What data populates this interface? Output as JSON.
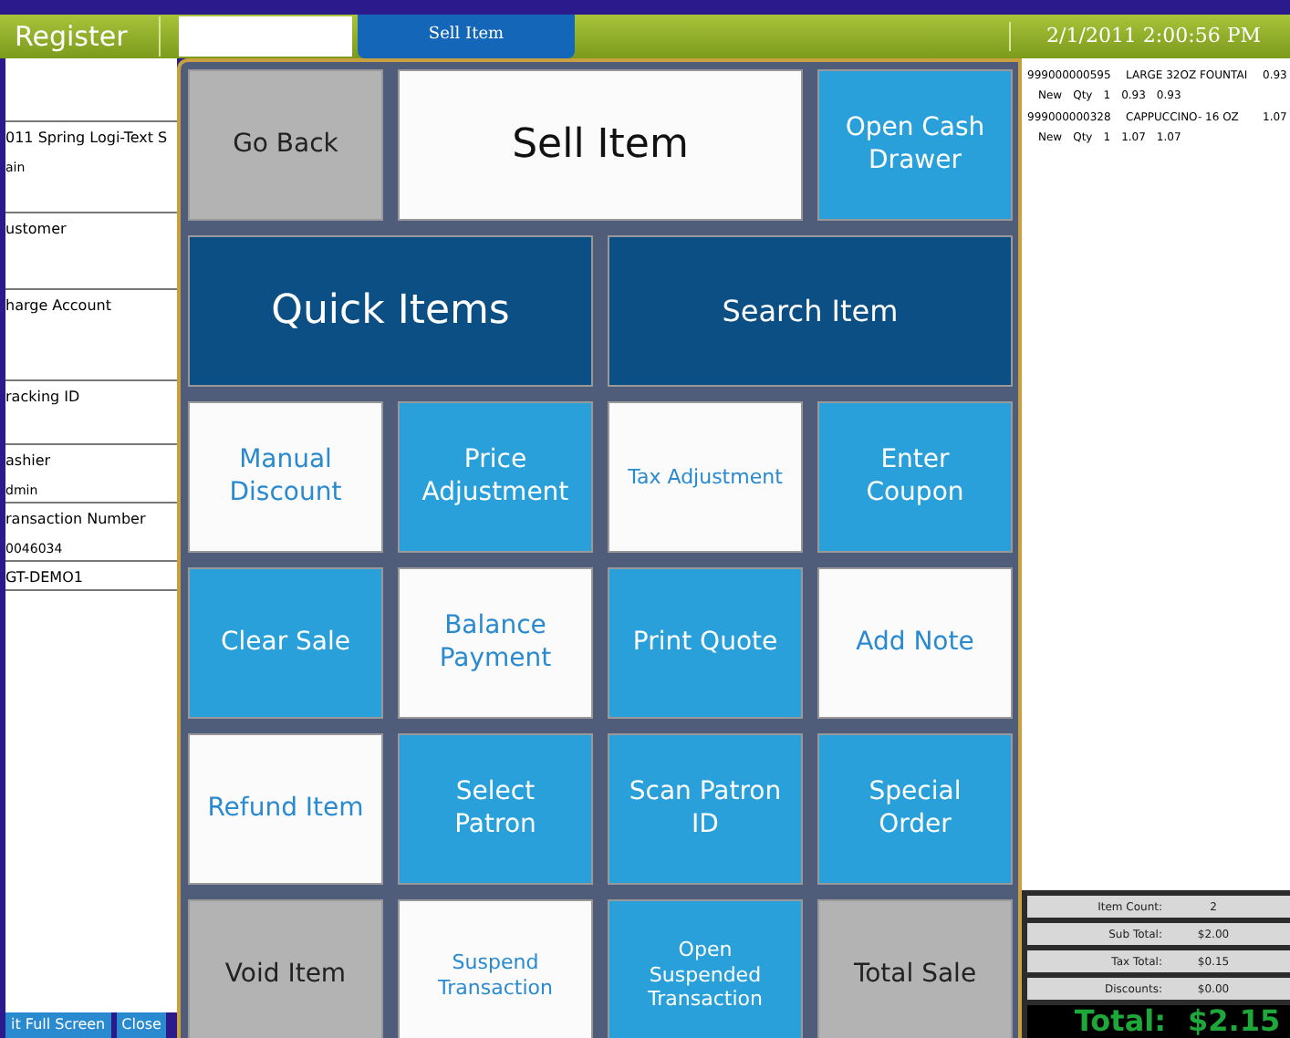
{
  "header": {
    "title": "Register",
    "tab": {
      "label": "Sell Item",
      "selected": true
    },
    "datetime": "2/1/2011 2:00:56 PM"
  },
  "left_panel": {
    "fields": [
      {
        "label": "011 Spring Logi-Text S",
        "value": "ain"
      },
      {
        "label": "ustomer"
      },
      {
        "label": "harge Account"
      },
      {
        "label": "racking ID"
      },
      {
        "label": "ashier",
        "value": "dmin"
      },
      {
        "label": "ransaction Number",
        "value": "0046034"
      },
      {
        "label": "GT-DEMO1"
      }
    ],
    "buttons": [
      "it Full Screen",
      "Close"
    ]
  },
  "tiles": [
    {
      "label": "Go Back",
      "kind": "gray"
    },
    {
      "label": "Sell Item",
      "kind": "plain",
      "wide": true
    },
    {
      "label": "Open Cash Drawer",
      "kind": "blue"
    },
    {
      "label": "Quick Items",
      "kind": "navy",
      "wide": true
    },
    {
      "label": "Search Item",
      "kind": "navy",
      "wide": true,
      "compact": true
    },
    {
      "label": "Manual Discount",
      "kind": "white"
    },
    {
      "label": "Price Adjustment",
      "kind": "blue"
    },
    {
      "label": "Tax Adjustment",
      "kind": "white",
      "compact": true
    },
    {
      "label": "Enter Coupon",
      "kind": "blue"
    },
    {
      "label": "Clear Sale",
      "kind": "blue"
    },
    {
      "label": "Balance Payment",
      "kind": "white"
    },
    {
      "label": "Print Quote",
      "kind": "blue"
    },
    {
      "label": "Add Note",
      "kind": "white"
    },
    {
      "label": "Refund Item",
      "kind": "white"
    },
    {
      "label": "Select Patron",
      "kind": "blue"
    },
    {
      "label": "Scan Patron ID",
      "kind": "blue"
    },
    {
      "label": "Special Order",
      "kind": "blue"
    },
    {
      "label": "Void Item",
      "kind": "gray"
    },
    {
      "label": "Suspend Transaction",
      "kind": "white",
      "compact": true
    },
    {
      "label": "Open Suspended Transaction",
      "kind": "blue",
      "compact": true
    },
    {
      "label": "Total Sale",
      "kind": "gray"
    }
  ],
  "items": [
    {
      "code": "999000000595",
      "name": "LARGE 32OZ FOUNTAI",
      "amount": "0.93",
      "status": "New",
      "qty_label": "Qty",
      "qty": "1",
      "price": "0.93",
      "total": "0.93"
    },
    {
      "code": "999000000328",
      "name": "CAPPUCCINO- 16 OZ",
      "amount": "1.07",
      "status": "New",
      "qty_label": "Qty",
      "qty": "1",
      "price": "1.07",
      "total": "1.07"
    }
  ],
  "totals": [
    {
      "label": "Item Count:",
      "value": "2"
    },
    {
      "label": "Sub Total:",
      "value": "$2.00"
    },
    {
      "label": "Tax Total:",
      "value": "$0.15"
    },
    {
      "label": "Discounts:",
      "value": "$0.00"
    }
  ],
  "grand_total": {
    "label": "Total:",
    "value": "$2.15"
  }
}
